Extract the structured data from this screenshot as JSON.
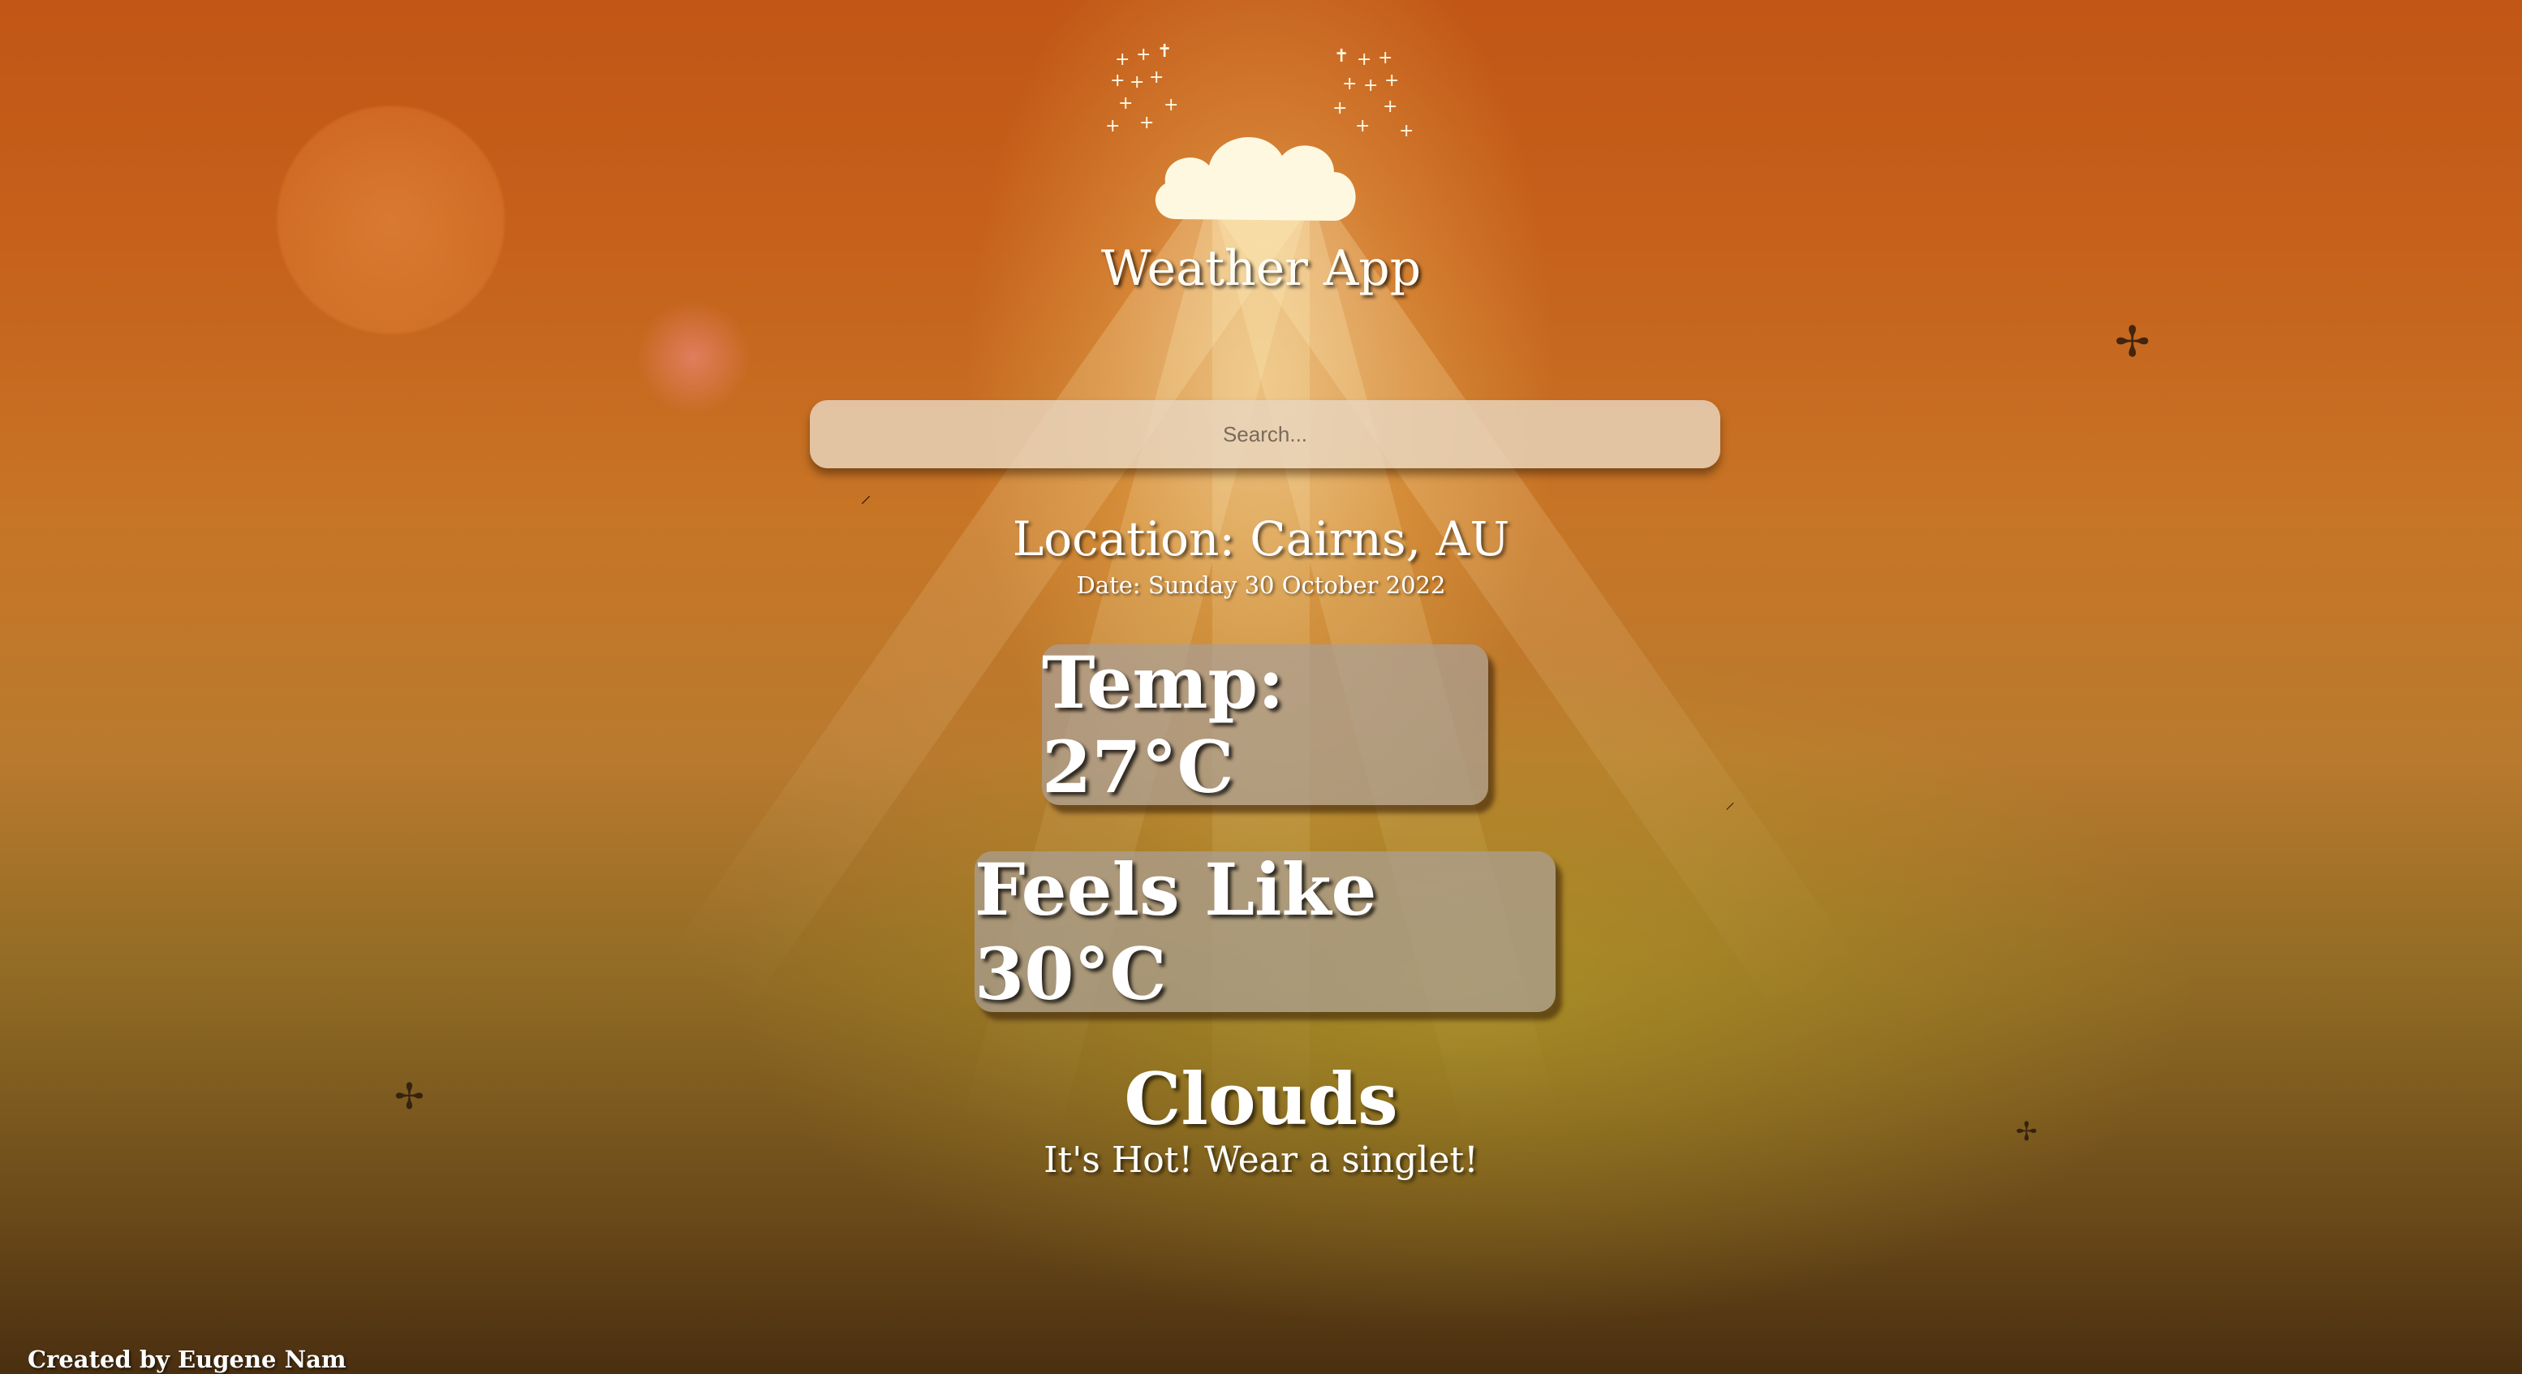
{
  "header": {
    "logo_icon": "cloud-with-sparkles-icon",
    "title": "Weather App"
  },
  "search": {
    "placeholder": "Search..."
  },
  "weather": {
    "location": "Location: Cairns, AU",
    "date": "Date: Sunday 30 October 2022",
    "temp": "Temp: 27°C",
    "feels_like": "Feels Like 30°C",
    "condition": "Clouds",
    "advice": "It's Hot! Wear a singlet!"
  },
  "footer": {
    "credit": "Created by Eugene Nam"
  },
  "colors": {
    "sky_top": "#c15616",
    "sky_bottom": "#4a2f10",
    "cloud": "#fff8e1",
    "card_bg": "#aaa096"
  }
}
